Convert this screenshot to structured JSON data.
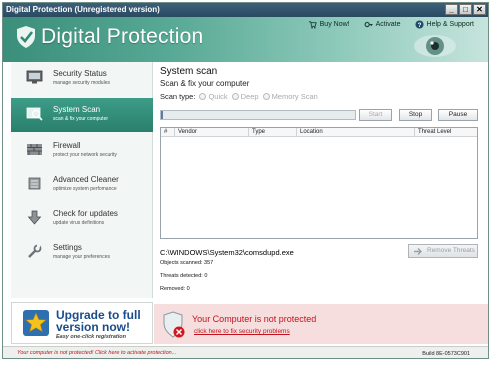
{
  "window": {
    "title": "Digital Protection (Unregistered version)",
    "controls": {
      "minimize": "_",
      "maximize": "□",
      "close": "✕"
    }
  },
  "header": {
    "logo_text": "Digital Protection",
    "links": [
      {
        "label": "Buy Now!",
        "icon": "cart-icon"
      },
      {
        "label": "Activate",
        "icon": "key-icon"
      },
      {
        "label": "Help & Support",
        "icon": "help-icon"
      }
    ],
    "brand_color": "#3a8f7a"
  },
  "sidebar": {
    "items": [
      {
        "title": "Security Status",
        "subtitle": "manage security modules",
        "icon": "monitor-icon",
        "active": false
      },
      {
        "title": "System Scan",
        "subtitle": "scan & fix your computer",
        "icon": "scan-icon",
        "active": true
      },
      {
        "title": "Firewall",
        "subtitle": "protect your network security",
        "icon": "firewall-icon",
        "active": false
      },
      {
        "title": "Advanced Cleaner",
        "subtitle": "optimize system perfomance",
        "icon": "cleaner-icon",
        "active": false
      },
      {
        "title": "Check for updates",
        "subtitle": "update virus definitions",
        "icon": "download-arrow-icon",
        "active": false
      },
      {
        "title": "Settings",
        "subtitle": "manage your preferences",
        "icon": "wrench-icon",
        "active": false
      }
    ],
    "upgrade": {
      "line1": "Upgrade to full",
      "line2": "version now!",
      "note": "Easy one-click registration"
    }
  },
  "main": {
    "title": "System scan",
    "subtitle": "Scan & fix your computer",
    "scan_type_label": "Scan type:",
    "scan_options": [
      "Quick",
      "Deep",
      "Memory Scan"
    ],
    "progress": 0.01,
    "buttons": {
      "start": "Start",
      "stop": "Stop",
      "pause": "Pause"
    },
    "table_headers": [
      "#",
      "Vendor",
      "Type",
      "Location",
      "Threat Level"
    ],
    "current_file": "C:\\WINDOWS\\System32\\comsdupd.exe",
    "stats": {
      "objects_scanned": "Objects scanned: 357",
      "threats_detected": "Threats detected: 0",
      "removed": "Removed: 0"
    },
    "remove_button": "Remove Threats"
  },
  "alert": {
    "title": "Your Computer is not protected",
    "link": "click here to fix security problems",
    "color": "#c4121d"
  },
  "statusbar": {
    "warning": "Your computer is not protected! Click here to activate protection...",
    "build": "Build 8E-0573C901"
  }
}
